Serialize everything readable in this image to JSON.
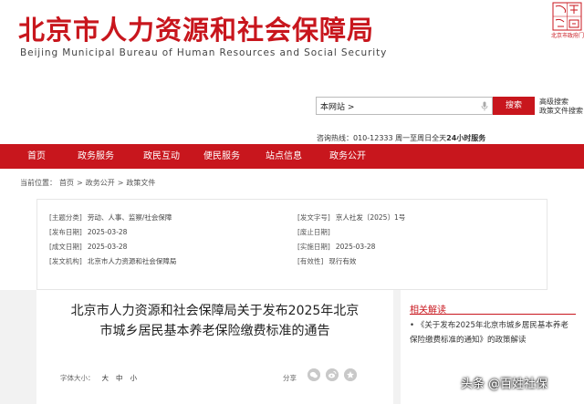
{
  "header": {
    "title": "北京市人力资源和社会保障局",
    "subtitle": "Beijing Municipal Bureau of Human Resources and Social Security",
    "emblem_chars": [
      "首",
      "都",
      "之",
      "窗"
    ],
    "emblem_label": "北京市政府门户网站"
  },
  "search": {
    "value": "本网站 >",
    "button": "搜索",
    "advanced": "高级搜索",
    "policy_search": "政策文件搜索"
  },
  "hotline": {
    "label": "咨询热线：",
    "number": "010-12333",
    "hours": "周一至周日全天",
    "service": "24小时服务"
  },
  "nav": {
    "items": [
      "首页",
      "政务服务",
      "政民互动",
      "便民服务",
      "站点信息",
      "政务公开"
    ]
  },
  "breadcrumb": {
    "prefix": "当前位置：",
    "items": [
      "首页",
      "政务公开",
      "政策文件"
    ],
    "separator": ">"
  },
  "meta": {
    "category_label": "[主题分类]",
    "category": "劳动、人事、监察/社会保障",
    "doc_no_label": "[发文字号]",
    "doc_no": "京人社发〔2025〕1号",
    "publish_label": "[发布日期]",
    "publish": "2025-03-28",
    "expire_label": "[废止日期]",
    "expire": "",
    "created_label": "[成文日期]",
    "created": "2025-03-28",
    "effective_label": "[实施日期]",
    "effective": "2025-03-28",
    "issuer_label": "[发文机构]",
    "issuer": "北京市人力资源和社会保障局",
    "validity_label": "[有效性]",
    "validity": "现行有效"
  },
  "article": {
    "title_line1": "北京市人力资源和社会保障局关于发布2025年北京",
    "title_line2": "市城乡居民基本养老保险缴费标准的通告",
    "font_label": "字体大小：",
    "font_sizes": [
      "大",
      "中",
      "小"
    ],
    "share_label": "分享",
    "share_icons": [
      "wechat-icon",
      "weibo-icon",
      "qzone-icon"
    ]
  },
  "side": {
    "heading": "相关解读",
    "item": "《关于发布2025年北京市城乡居民基本养老保险缴费标准的通知》的政策解读"
  },
  "watermark": "头条 @百姓社保",
  "colors": {
    "brand_red": "#c8161d",
    "page_gray": "#f2f2f2"
  }
}
